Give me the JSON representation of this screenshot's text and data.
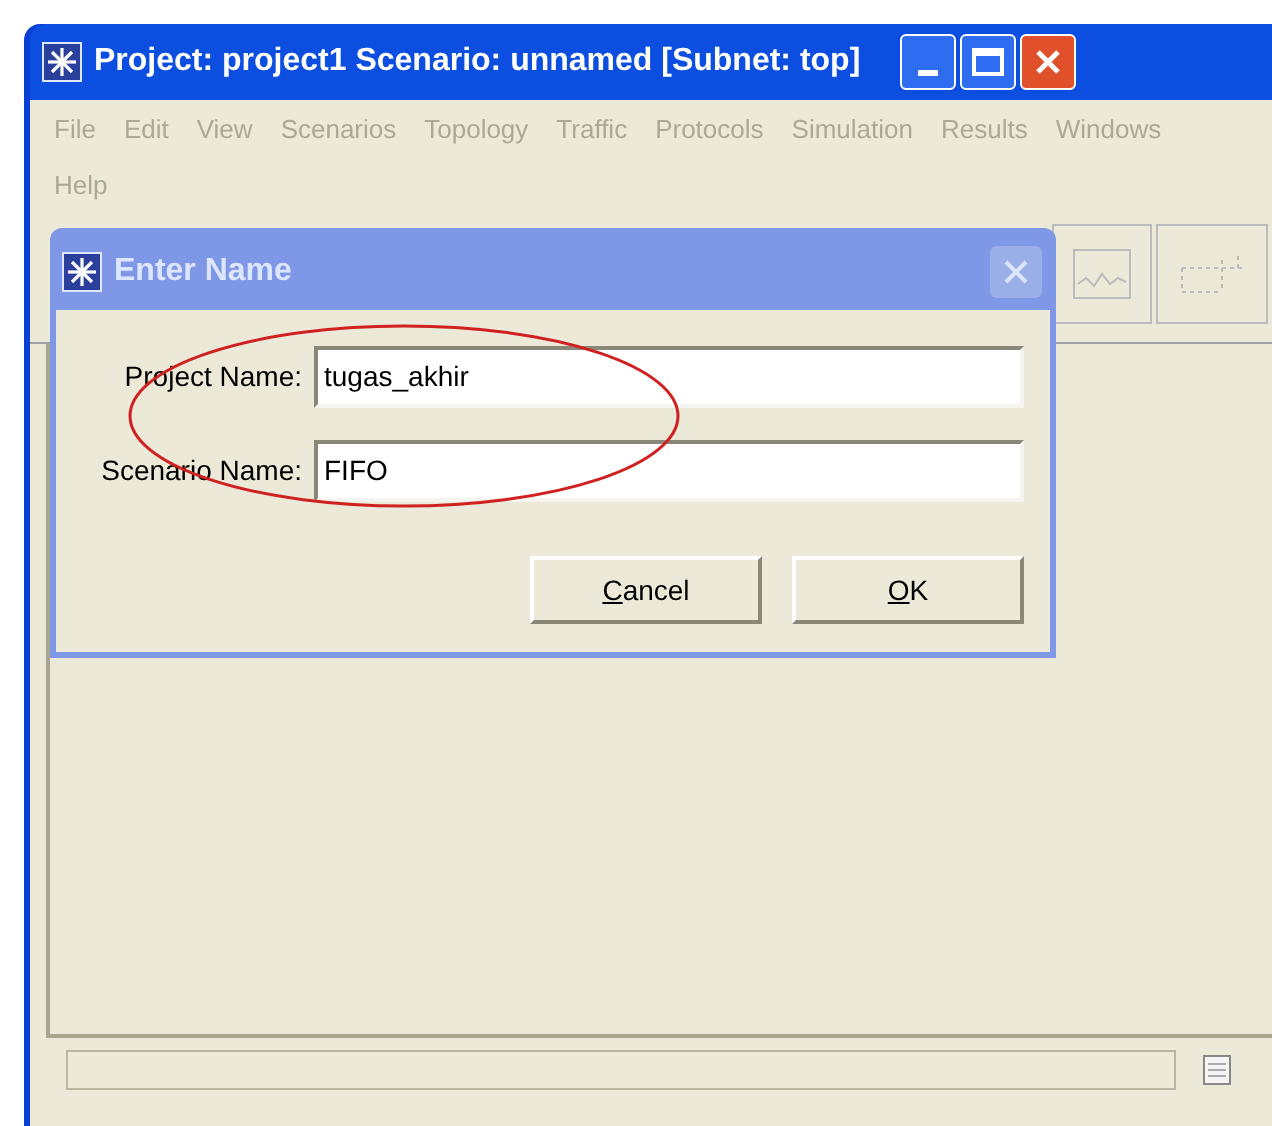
{
  "window": {
    "title": "Project: project1 Scenario: unnamed  [Subnet: top]"
  },
  "menu": [
    {
      "label": "File",
      "disabled": true
    },
    {
      "label": "Edit",
      "disabled": true
    },
    {
      "label": "View",
      "disabled": true
    },
    {
      "label": "Scenarios",
      "disabled": true
    },
    {
      "label": "Topology",
      "disabled": true
    },
    {
      "label": "Traffic",
      "disabled": true
    },
    {
      "label": "Protocols",
      "disabled": true
    },
    {
      "label": "Simulation",
      "disabled": true
    },
    {
      "label": "Results",
      "disabled": true
    },
    {
      "label": "Windows",
      "disabled": true
    },
    {
      "label": "Help",
      "disabled": true
    }
  ],
  "dialog": {
    "title": "Enter Name",
    "fields": [
      {
        "label": "Project Name:",
        "value": "tugas_akhir"
      },
      {
        "label": "Scenario Name:",
        "value": "FIFO"
      }
    ],
    "buttons": [
      {
        "label": "**C**ancel"
      },
      {
        "label": "**O**K"
      }
    ]
  }
}
